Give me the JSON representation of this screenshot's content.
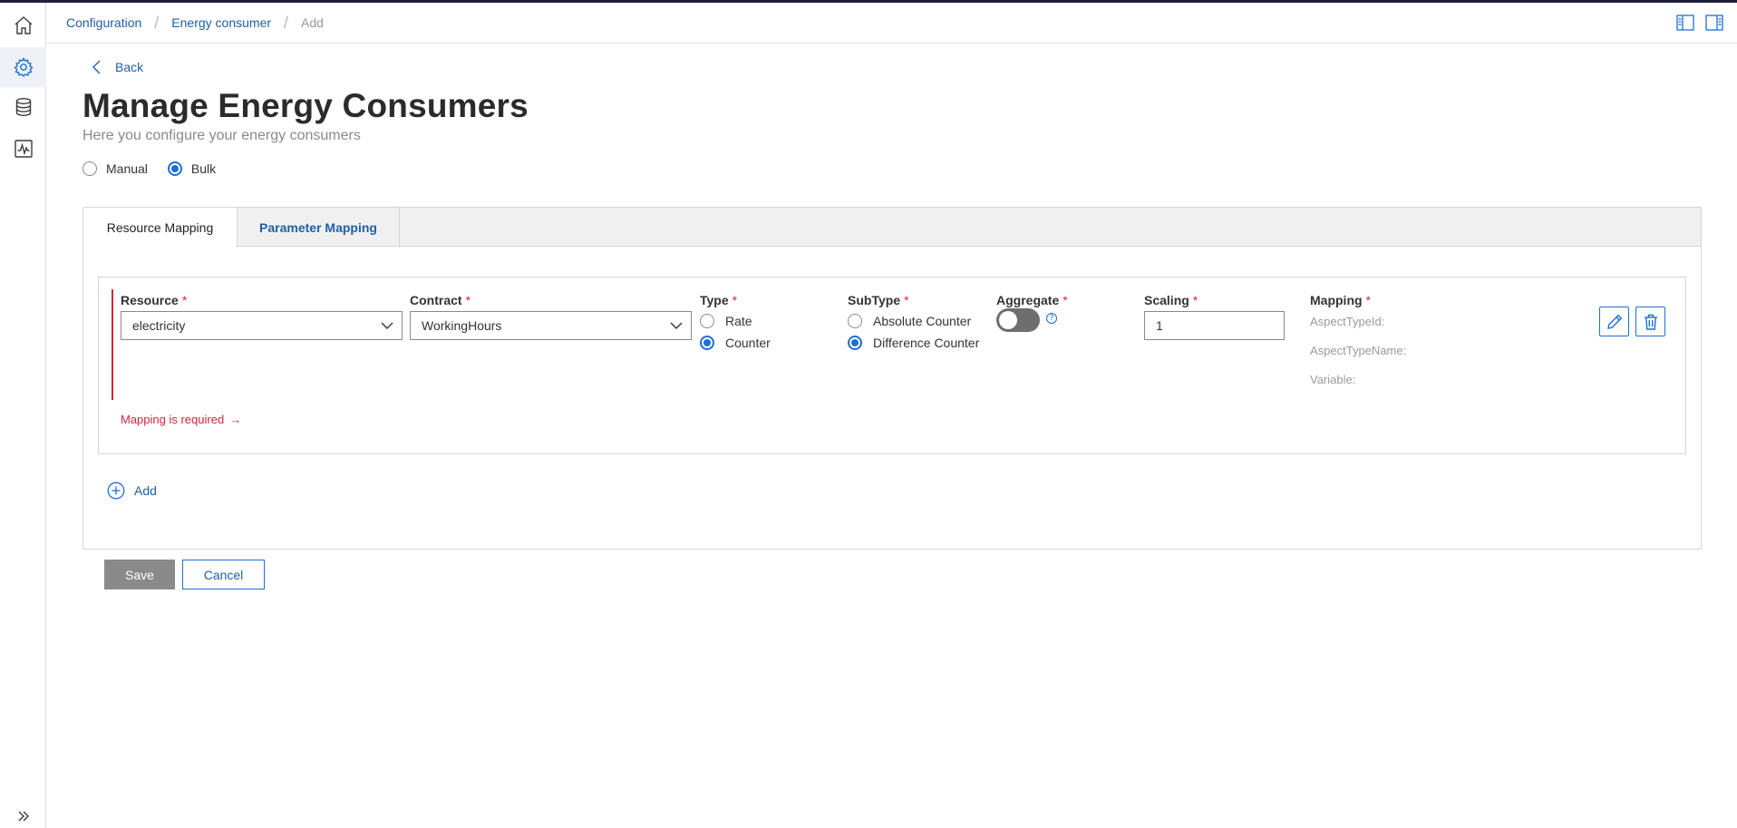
{
  "breadcrumb": {
    "items": [
      "Configuration",
      "Energy consumer"
    ],
    "current": "Add"
  },
  "back_label": "Back",
  "page": {
    "title": "Manage Energy Consumers",
    "subtitle": "Here you configure your energy consumers"
  },
  "mode": {
    "options": [
      "Manual",
      "Bulk"
    ],
    "selected": "Bulk"
  },
  "tabs": [
    {
      "label": "Resource Mapping",
      "active": true
    },
    {
      "label": "Parameter Mapping",
      "active": false
    }
  ],
  "row": {
    "resource": {
      "label": "Resource",
      "required": "*",
      "value": "electricity"
    },
    "contract": {
      "label": "Contract",
      "required": "*",
      "value": "WorkingHours"
    },
    "type": {
      "label": "Type",
      "required": "*",
      "options": [
        "Rate",
        "Counter"
      ],
      "selected": "Counter"
    },
    "subtype": {
      "label": "SubType",
      "required": "*",
      "options": [
        "Absolute Counter",
        "Difference Counter"
      ],
      "selected": "Difference Counter"
    },
    "aggregate": {
      "label": "Aggregate",
      "required": "*",
      "enabled": false,
      "help": "?"
    },
    "scaling": {
      "label": "Scaling",
      "required": "*",
      "value": "1"
    },
    "mapping": {
      "label": "Mapping",
      "required": "*",
      "aspect_type_id": "AspectTypeId:",
      "aspect_type_name": "AspectTypeName:",
      "variable": "Variable:"
    },
    "error": {
      "message": "Mapping is required",
      "arrow": "→"
    }
  },
  "add_label": "Add",
  "actions": {
    "save": "Save",
    "cancel": "Cancel"
  },
  "colors": {
    "accent": "#1f6fd1",
    "link": "#1f5fa8",
    "error": "#d6243f",
    "disabled": "#8a8a8a"
  }
}
